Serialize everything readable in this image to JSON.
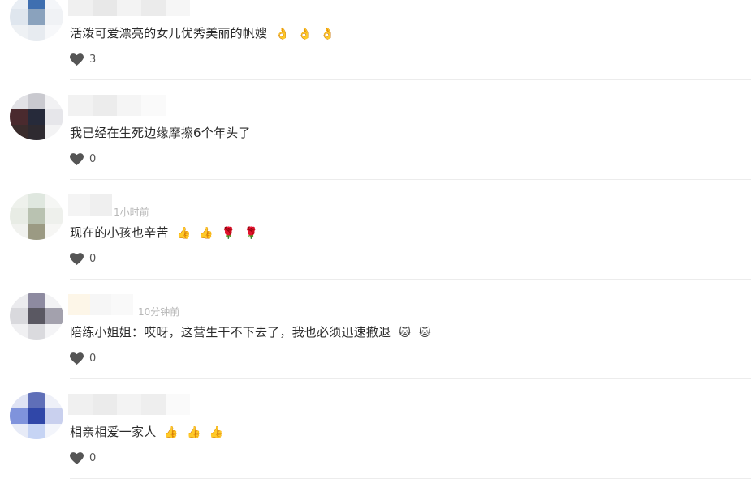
{
  "comments": [
    {
      "text": "活泼可爱漂亮的女儿优秀美丽的帆嫂",
      "emojis": [
        "👌",
        "👌",
        "👌"
      ],
      "time": "",
      "likes": "3"
    },
    {
      "text": "我已经在生死边缘摩擦6个年头了",
      "emojis": [],
      "time": "",
      "likes": "0"
    },
    {
      "text": "现在的小孩也辛苦",
      "emojis": [
        "👍",
        "👍",
        "🌹",
        "🌹"
      ],
      "time": "1小时前",
      "likes": "0"
    },
    {
      "text": "陪练小姐姐：哎呀，这营生干不下去了，我也必须迅速撤退",
      "emojis": [
        "🐱",
        "🐱"
      ],
      "time": "10分钟前",
      "likes": "0"
    },
    {
      "text": "相亲相爱一家人",
      "emojis": [
        "👍",
        "👍",
        "👍"
      ],
      "time": "",
      "likes": "0"
    }
  ],
  "icons": {
    "like": "heart-icon"
  },
  "colors": {
    "text": "#2b2b2b",
    "time": "#b7b7b7",
    "heart": "#555555"
  }
}
